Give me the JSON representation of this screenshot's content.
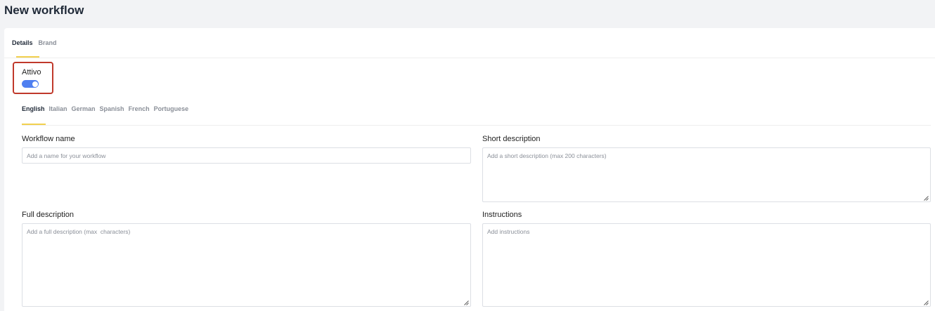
{
  "page": {
    "title": "New workflow"
  },
  "tabs": [
    {
      "label": "Details",
      "active": true
    },
    {
      "label": "Brand",
      "active": false
    }
  ],
  "active_toggle": {
    "label": "Attivo",
    "value": true,
    "color": "#4f7ff0"
  },
  "languages": [
    {
      "label": "English",
      "active": true
    },
    {
      "label": "Italian",
      "active": false
    },
    {
      "label": "German",
      "active": false
    },
    {
      "label": "Spanish",
      "active": false
    },
    {
      "label": "French",
      "active": false
    },
    {
      "label": "Portuguese",
      "active": false
    }
  ],
  "form": {
    "workflow_name": {
      "label": "Workflow name",
      "value": "",
      "placeholder": "Add a name for your workflow"
    },
    "short_description": {
      "label": "Short description",
      "value": "",
      "placeholder": "Add a short description (max 200 characters)"
    },
    "full_description": {
      "label": "Full description",
      "value": "",
      "placeholder": "Add a full description (max  characters)"
    },
    "instructions": {
      "label": "Instructions",
      "value": "",
      "placeholder": "Add instructions"
    }
  },
  "colors": {
    "accent_underline": "#f2d04e",
    "highlight_border": "#c0392b"
  }
}
